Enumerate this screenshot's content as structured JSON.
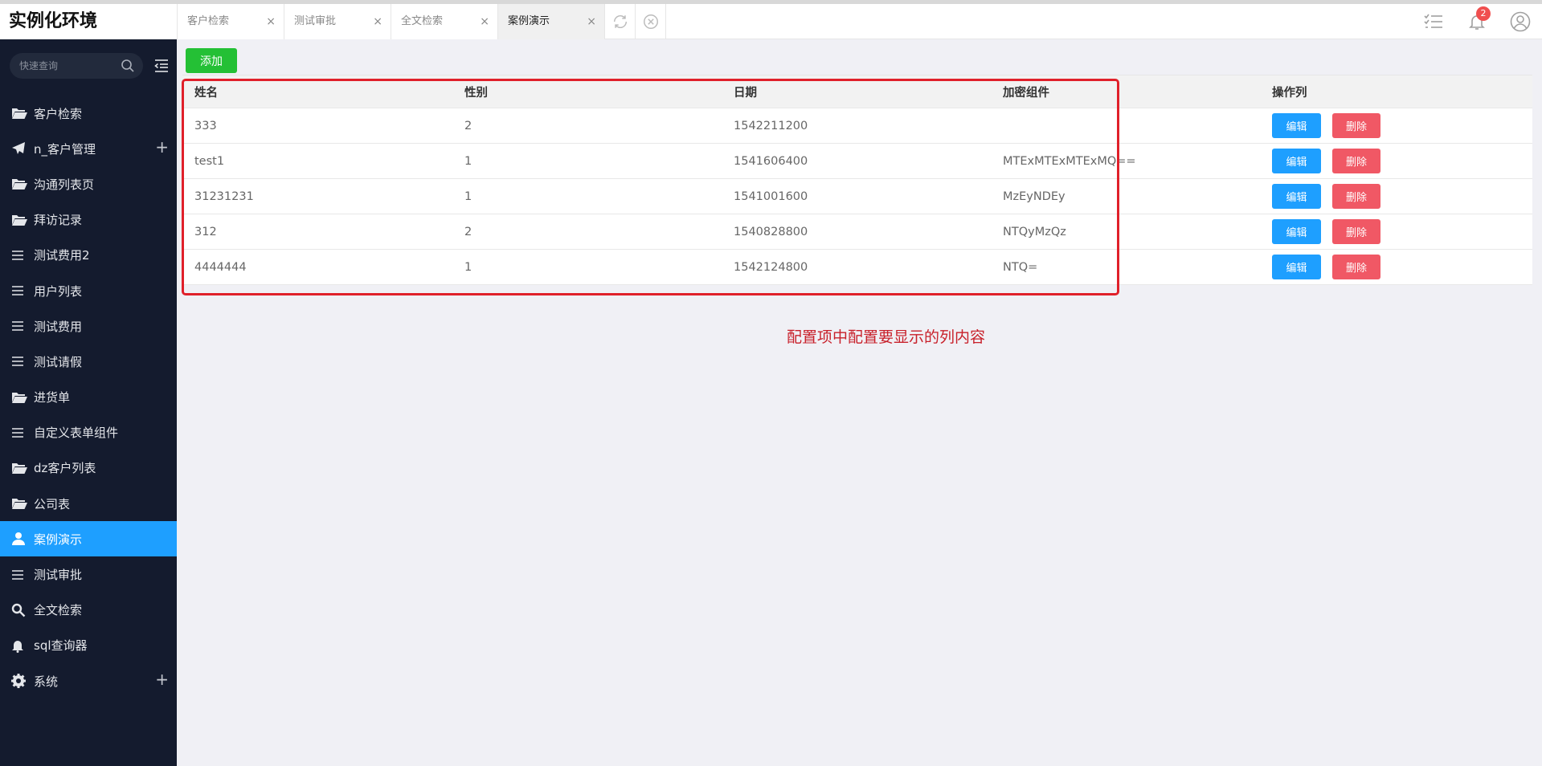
{
  "app": {
    "title": "实例化环境"
  },
  "tabs": [
    {
      "label": "客户检索",
      "close": "×"
    },
    {
      "label": "测试审批",
      "close": "×"
    },
    {
      "label": "全文检索",
      "close": "×"
    },
    {
      "label": "案例演示",
      "close": "×",
      "active": true
    }
  ],
  "header": {
    "notification_count": "2"
  },
  "sidebar": {
    "search_placeholder": "快速查询",
    "items": [
      {
        "label": "客户检索",
        "icon": "folder-open-icon"
      },
      {
        "label": "n_客户管理",
        "icon": "paper-plane-icon",
        "expand": "+"
      },
      {
        "label": "沟通列表页",
        "icon": "folder-open-icon"
      },
      {
        "label": "拜访记录",
        "icon": "folder-open-icon"
      },
      {
        "label": "测试费用2",
        "icon": "list-icon"
      },
      {
        "label": "用户列表",
        "icon": "list-icon"
      },
      {
        "label": "测试费用",
        "icon": "list-icon"
      },
      {
        "label": "测试请假",
        "icon": "list-icon"
      },
      {
        "label": "进货单",
        "icon": "folder-open-icon"
      },
      {
        "label": "自定义表单组件",
        "icon": "list-icon"
      },
      {
        "label": "dz客户列表",
        "icon": "folder-open-icon"
      },
      {
        "label": "公司表",
        "icon": "folder-open-icon"
      },
      {
        "label": "案例演示",
        "icon": "user-icon",
        "active": true
      },
      {
        "label": "测试审批",
        "icon": "list-icon"
      },
      {
        "label": "全文检索",
        "icon": "search-icon"
      },
      {
        "label": "sql查询器",
        "icon": "bell-icon"
      },
      {
        "label": "系统",
        "icon": "gear-icon",
        "expand": "+"
      }
    ]
  },
  "toolbar": {
    "add_label": "添加"
  },
  "table": {
    "columns": [
      "姓名",
      "性别",
      "日期",
      "加密组件",
      "操作列"
    ],
    "rows": [
      [
        "333",
        "2",
        "1542211200",
        ""
      ],
      [
        "test1",
        "1",
        "1541606400",
        "MTExMTExMTExMQ=="
      ],
      [
        "31231231",
        "1",
        "1541001600",
        "MzEyNDEy"
      ],
      [
        "312",
        "2",
        "1540828800",
        "NTQyMzQz"
      ],
      [
        "4444444",
        "1",
        "1542124800",
        "NTQ="
      ]
    ],
    "edit_label": "编辑",
    "delete_label": "删除"
  },
  "annotation": {
    "text": "配置项中配置要显示的列内容",
    "color": "#c8202a"
  },
  "colors": {
    "sidebar_bg": "#141b2e",
    "accent": "#1e9fff",
    "add": "#24c035",
    "danger": "#f05865"
  }
}
